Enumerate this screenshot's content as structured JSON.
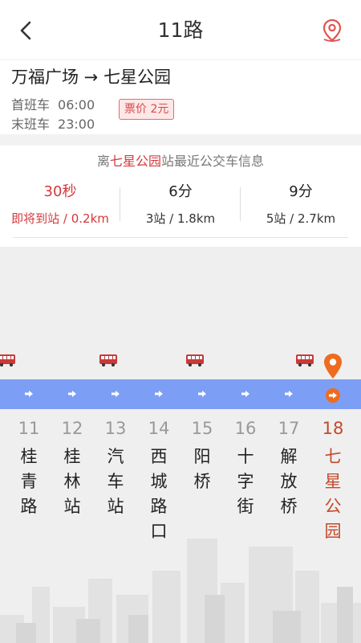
{
  "header": {
    "title": "11路"
  },
  "route": {
    "name": "万福广场 → 七星公园",
    "first_label": "首班车",
    "first_time": "06:00",
    "last_label": "末班车",
    "last_time": "23:00",
    "fare": "票价 2元"
  },
  "arrival": {
    "title_prefix": "离",
    "station": "七星公园",
    "title_suffix": "站最近公交车信息",
    "buses": [
      {
        "time": "30秒",
        "detail": "即将到站 / 0.2km"
      },
      {
        "time": "6分",
        "detail": "3站 / 1.8km"
      },
      {
        "time": "9分",
        "detail": "5站 / 2.7km"
      }
    ]
  },
  "stops": [
    {
      "num": "11",
      "name": "桂青路"
    },
    {
      "num": "12",
      "name": "桂林站"
    },
    {
      "num": "13",
      "name": "汽车站"
    },
    {
      "num": "14",
      "name": "西城路口"
    },
    {
      "num": "15",
      "name": "阳桥"
    },
    {
      "num": "16",
      "name": "十字街"
    },
    {
      "num": "17",
      "name": "解放桥"
    },
    {
      "num": "18",
      "name": "七星公园"
    }
  ],
  "colors": {
    "accent": "#d4393c",
    "track": "#7d9ef5",
    "destination": "#ee6b1f"
  },
  "icons": {
    "back": "chevron-left-icon",
    "location": "location-pin-icon",
    "bus": "bus-icon",
    "arrow": "arrow-right-icon"
  }
}
